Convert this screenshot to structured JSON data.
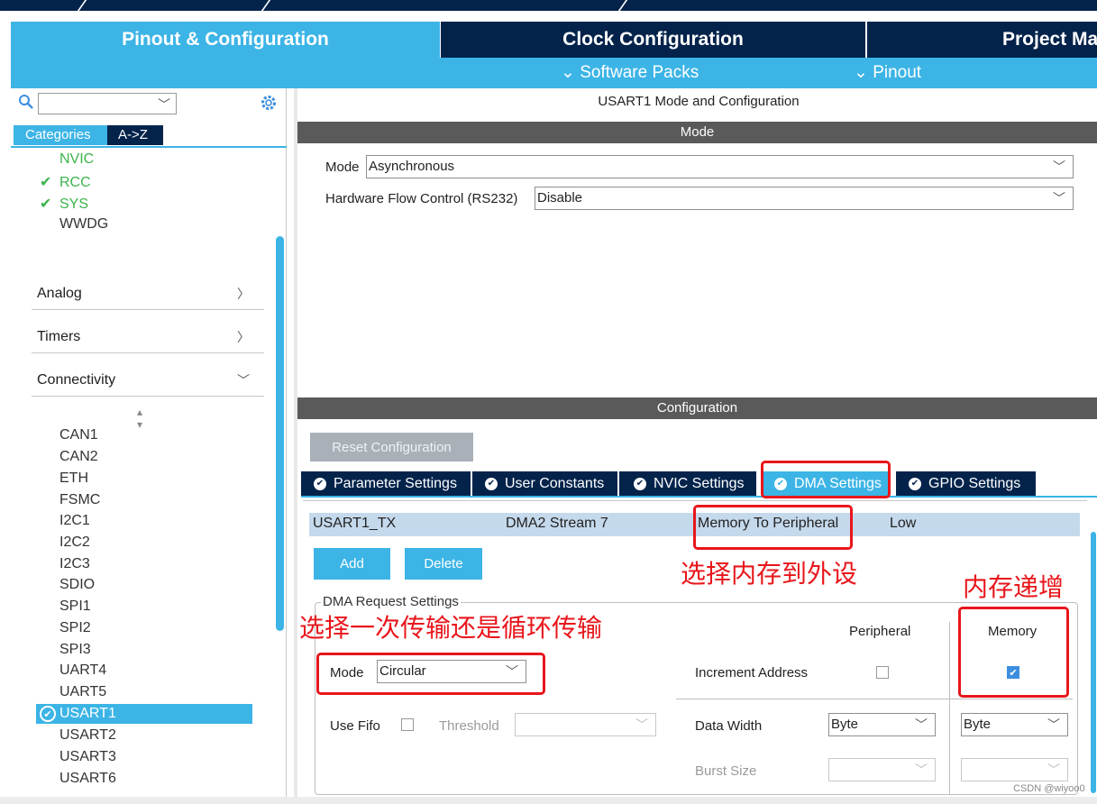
{
  "header": {
    "tabs": [
      {
        "label": "Pinout & Configuration",
        "active": true
      },
      {
        "label": "Clock Configuration",
        "active": false
      },
      {
        "label": "Project Ma",
        "active": false
      }
    ],
    "subbar": {
      "software_packs": "Software Packs",
      "pinout": "Pinout"
    }
  },
  "colors": {
    "accent": "#3cb4e6",
    "dark": "#03234b",
    "selected_row": "#c5d9ec",
    "annotation": "#e8161b",
    "ok_green": "#3cb44b"
  },
  "left": {
    "search_value": "",
    "tabs": {
      "categories": "Categories",
      "az": "A->Z"
    },
    "system_items": [
      {
        "label": "NVIC",
        "checked": false
      },
      {
        "label": "RCC",
        "checked": true
      },
      {
        "label": "SYS",
        "checked": true
      },
      {
        "label": "WWDG",
        "checked": false
      }
    ],
    "categories": [
      {
        "label": "Analog",
        "expanded": false
      },
      {
        "label": "Timers",
        "expanded": false
      },
      {
        "label": "Connectivity",
        "expanded": true
      }
    ],
    "connectivity_items": [
      "CAN1",
      "CAN2",
      "ETH",
      "FSMC",
      "I2C1",
      "I2C2",
      "I2C3",
      "SDIO",
      "SPI1",
      "SPI2",
      "SPI3",
      "UART4",
      "UART5",
      "USART1",
      "USART2",
      "USART3",
      "USART6"
    ],
    "selected_item": "USART1"
  },
  "main": {
    "title": "USART1 Mode and Configuration",
    "mode_section": "Mode",
    "mode_label": "Mode",
    "mode_value": "Asynchronous",
    "flow_label": "Hardware Flow Control (RS232)",
    "flow_value": "Disable",
    "config_section": "Configuration",
    "reset_button": "Reset Configuration",
    "config_tabs": [
      {
        "label": "Parameter Settings",
        "active": false
      },
      {
        "label": "User Constants",
        "active": false
      },
      {
        "label": "NVIC Settings",
        "active": false
      },
      {
        "label": "DMA Settings",
        "active": true
      },
      {
        "label": "GPIO Settings",
        "active": false
      }
    ],
    "dma_rows": [
      {
        "request": "USART1_TX",
        "stream": "DMA2 Stream 7",
        "direction": "Memory To Peripheral",
        "priority": "Low"
      }
    ],
    "add_button": "Add",
    "delete_button": "Delete",
    "dma_request": {
      "legend": "DMA Request Settings",
      "peripheral_header": "Peripheral",
      "memory_header": "Memory",
      "mode_label": "Mode",
      "mode_value": "Circular",
      "increment_label": "Increment Address",
      "peripheral_increment": false,
      "memory_increment": true,
      "use_fifo_label": "Use Fifo",
      "use_fifo": false,
      "threshold_label": "Threshold",
      "threshold_value": "",
      "data_width_label": "Data Width",
      "peripheral_width": "Byte",
      "memory_width": "Byte",
      "burst_size_label": "Burst Size",
      "peripheral_burst": "",
      "memory_burst": ""
    }
  },
  "annotations": {
    "memory_to_peripheral": "选择内存到外设",
    "memory_increment": "内存递增",
    "mode_choice": "选择一次传输还是循环传输"
  },
  "watermark": "CSDN @wiyoo0"
}
